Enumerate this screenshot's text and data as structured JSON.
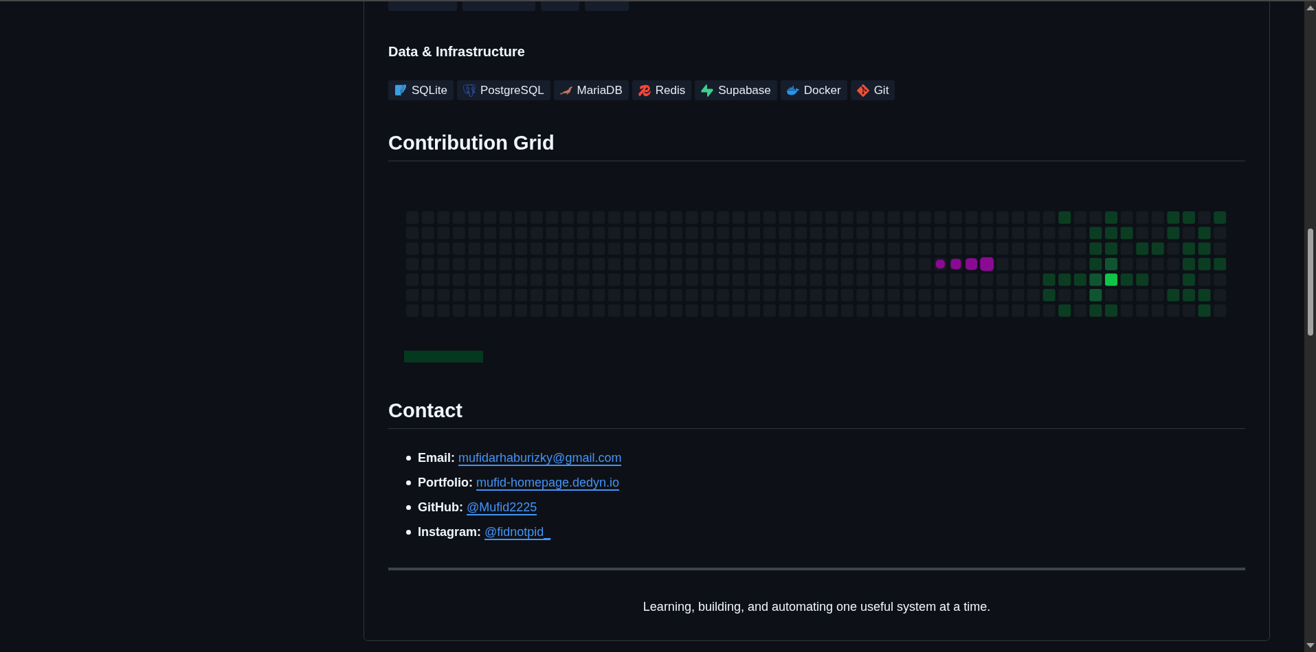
{
  "data_section": {
    "heading": "Data & Infrastructure",
    "badges": [
      "SQLite",
      "PostgreSQL",
      "MariaDB",
      "Redis",
      "Supabase",
      "Docker",
      "Git"
    ]
  },
  "contribution": {
    "heading": "Contribution Grid"
  },
  "contact": {
    "heading": "Contact",
    "items": [
      {
        "label": "Email:",
        "link": "mufidarhaburizky@gmail.com"
      },
      {
        "label": "Portfolio:",
        "link": "mufid-homepage.dedyn.io"
      },
      {
        "label": "GitHub:",
        "link": "@Mufid2225"
      },
      {
        "label": "Instagram:",
        "link": "@fidnotpid_"
      }
    ]
  },
  "footer": "Learning, building, and automating one useful system at a time."
}
